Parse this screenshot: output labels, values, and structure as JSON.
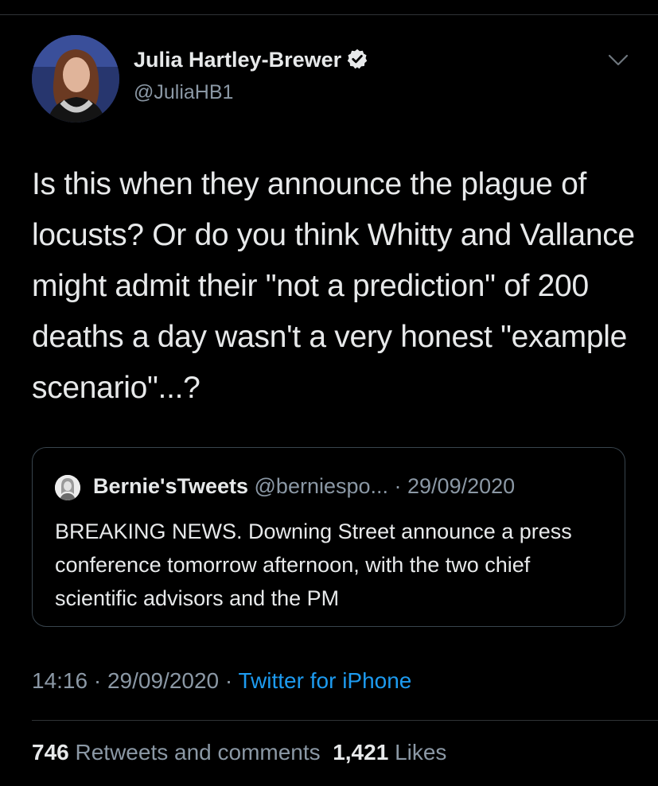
{
  "author": {
    "name": "Julia Hartley-Brewer",
    "handle": "@JuliaHB1",
    "verified": true
  },
  "tweet": {
    "text": "Is this when they announce the plague of locusts? Or do you think Whitty and Vallance might admit their \"not a prediction\" of 200 deaths a day wasn't a very honest \"example scenario\"...?"
  },
  "quoted_tweet": {
    "author_name": "Bernie'sTweets",
    "handle": "@berniespo...",
    "separator": " · ",
    "date": "29/09/2020",
    "text": "BREAKING NEWS. Downing Street announce a press conference tomorrow afternoon, with the two chief scientific advisors and the PM"
  },
  "meta": {
    "time": "14:16",
    "sep1": " · ",
    "date": "29/09/2020",
    "sep2": " · ",
    "source": "Twitter for iPhone"
  },
  "stats": {
    "retweets_count": "746",
    "retweets_label": "Retweets and comments",
    "likes_count": "1,421",
    "likes_label": "Likes"
  },
  "colors": {
    "background": "#000000",
    "link": "#1d9bf0",
    "secondary_text": "#8b98a5",
    "border": "#38444d"
  },
  "icons": [
    "verified-badge-icon",
    "chevron-down-icon"
  ]
}
